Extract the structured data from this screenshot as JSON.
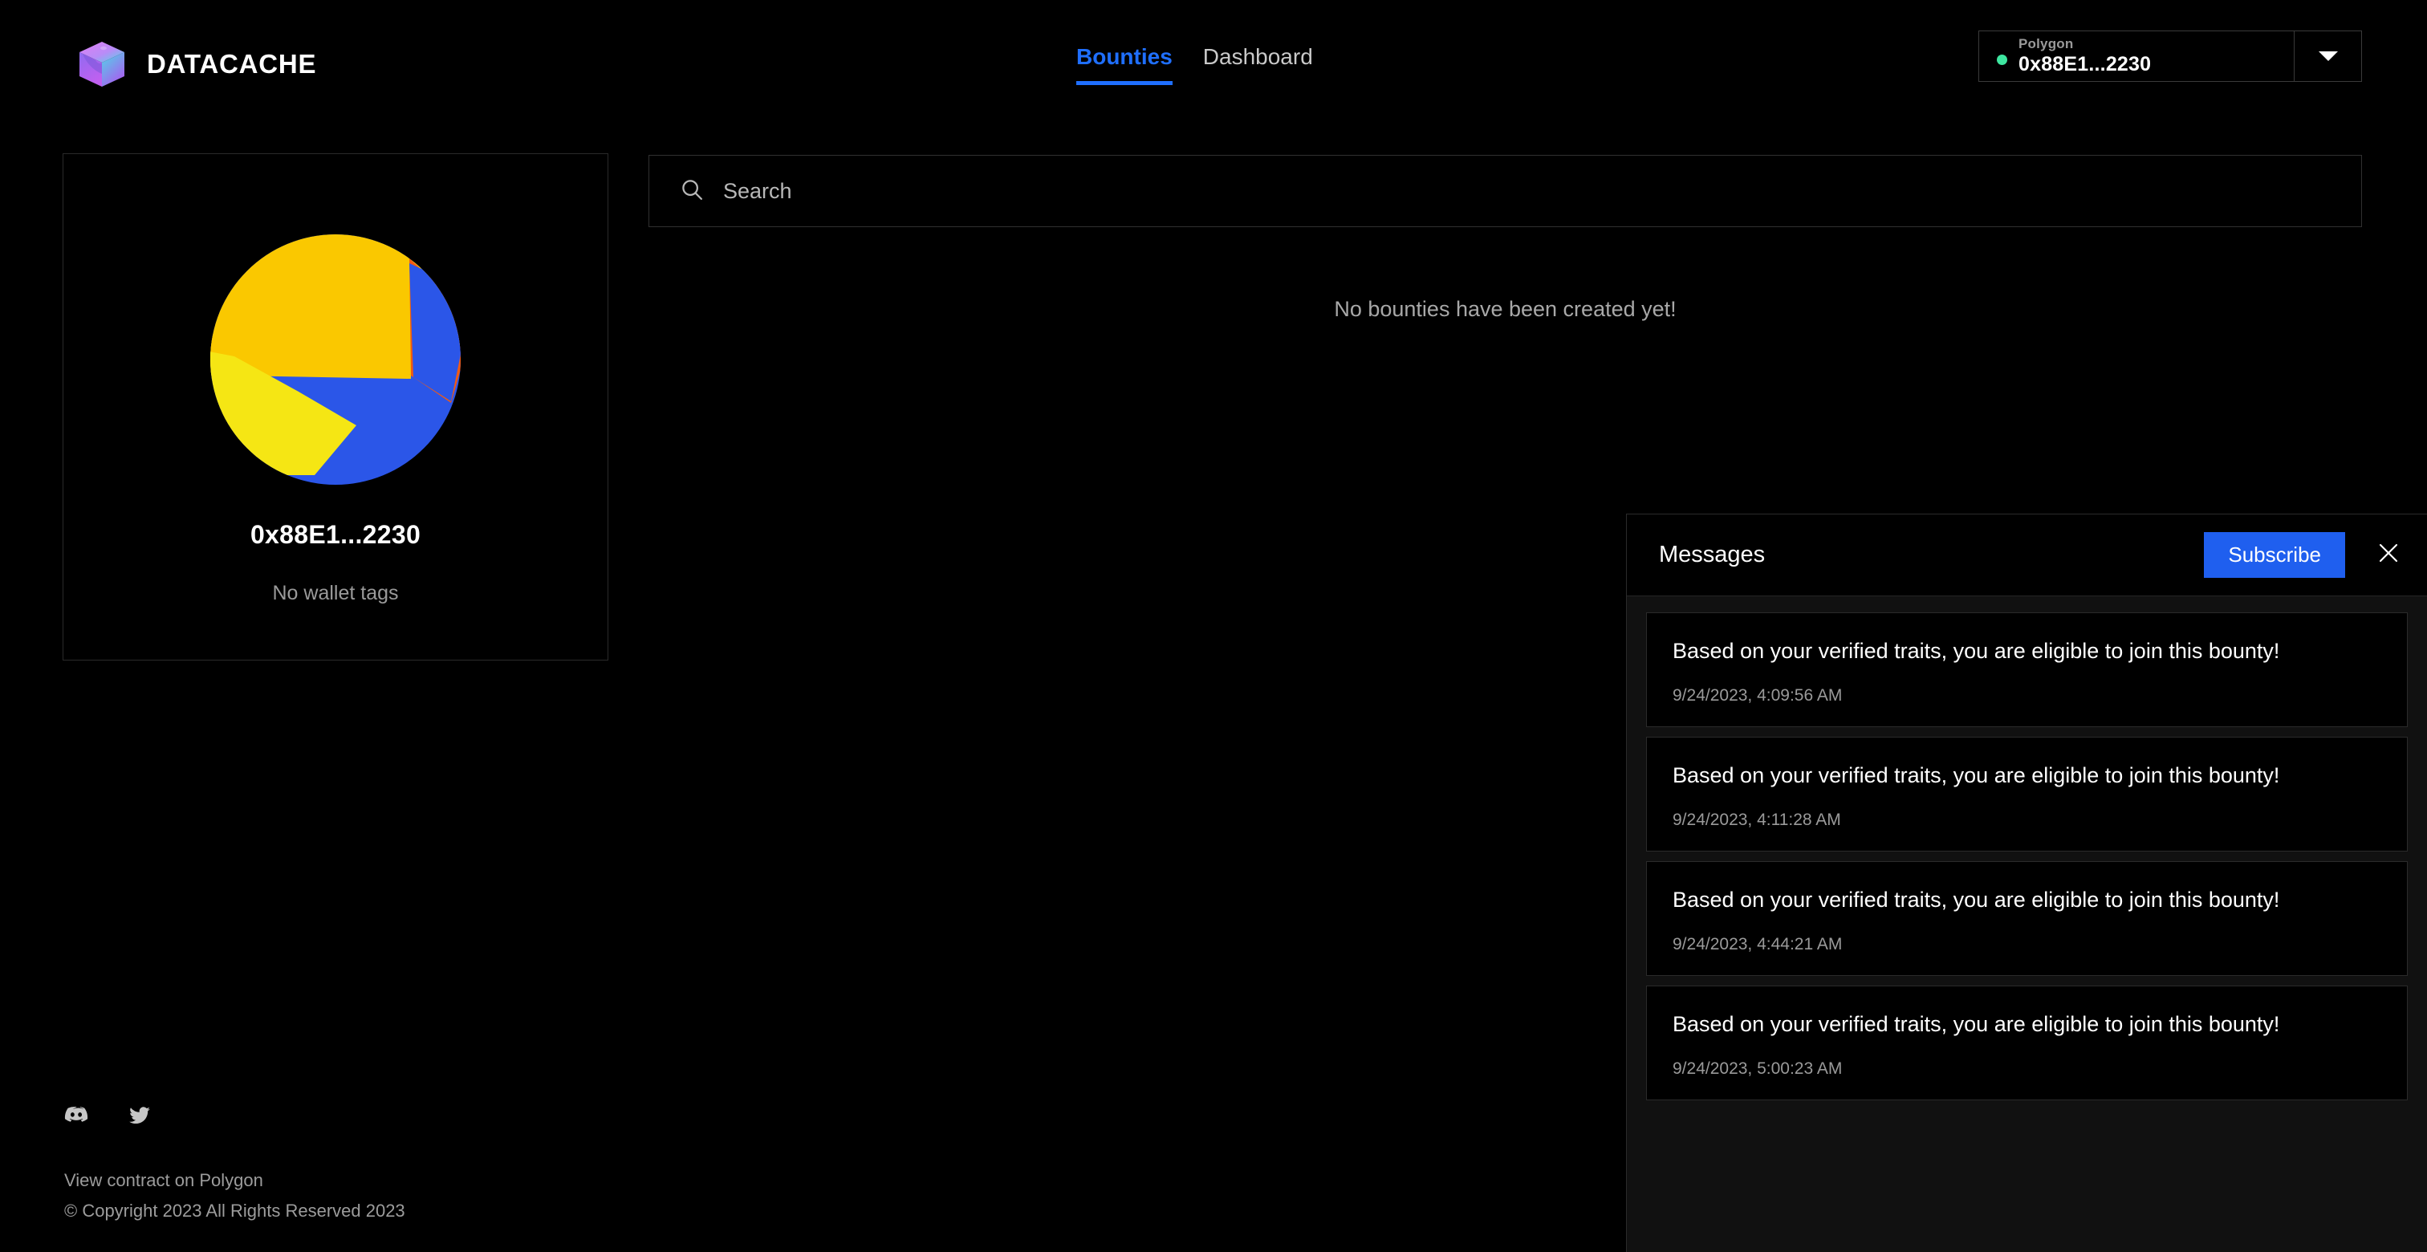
{
  "brand": {
    "name": "DATACACHE",
    "logo_icon": "cube-logo-icon"
  },
  "nav": {
    "items": [
      {
        "label": "Bounties",
        "active": true
      },
      {
        "label": "Dashboard",
        "active": false
      }
    ]
  },
  "wallet": {
    "network": "Polygon",
    "address": "0x88E1...2230",
    "status_color": "#3ee6a0",
    "caret_icon": "chevron-down-icon"
  },
  "profile": {
    "avatar_icon": "wallet-identicon-avatar",
    "address": "0x88E1...2230",
    "tags": "No wallet tags",
    "avatar_colors": {
      "amber": "#FAC800",
      "yellow": "#F5E614",
      "blue": "#2B56E8",
      "orange": "#F25A12"
    }
  },
  "search": {
    "placeholder": "Search",
    "value": "",
    "icon": "search-icon"
  },
  "main": {
    "empty_state": "No bounties have been created yet!"
  },
  "messages": {
    "title": "Messages",
    "subscribe_label": "Subscribe",
    "subscribe_color": "#1f5fef",
    "close_icon": "close-icon",
    "items": [
      {
        "text": "Based on your verified traits, you are eligible to join this bounty!",
        "time": "9/24/2023, 4:09:56 AM"
      },
      {
        "text": "Based on your verified traits, you are eligible to join this bounty!",
        "time": "9/24/2023, 4:11:28 AM"
      },
      {
        "text": "Based on your verified traits, you are eligible to join this bounty!",
        "time": "9/24/2023, 4:44:21 AM"
      },
      {
        "text": "Based on your verified traits, you are eligible to join this bounty!",
        "time": "9/24/2023, 5:00:23 AM"
      }
    ]
  },
  "footer": {
    "social": [
      {
        "name": "discord-icon"
      },
      {
        "name": "twitter-icon"
      }
    ],
    "contract_link": "View contract on Polygon",
    "copyright": "© Copyright 2023 All Rights Reserved 2023"
  }
}
